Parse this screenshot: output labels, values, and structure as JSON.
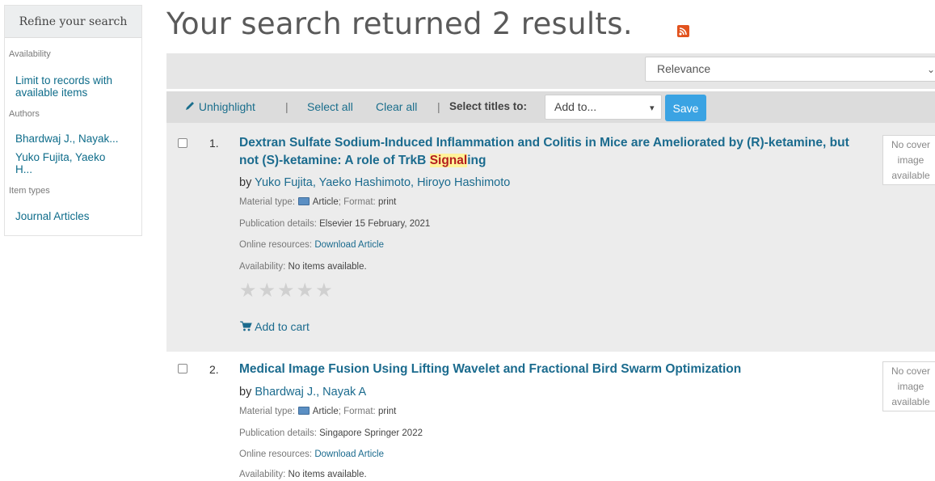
{
  "sidebar": {
    "heading": "Refine your search",
    "availability_label": "Availability",
    "availability_link": "Limit to records with available items",
    "authors_label": "Authors",
    "authors": [
      "Bhardwaj J., Nayak...",
      "Yuko Fujita, Yaeko H..."
    ],
    "item_types_label": "Item types",
    "item_types": [
      "Journal Articles"
    ]
  },
  "header": {
    "title": "Your search returned 2 results."
  },
  "sort": {
    "selected": "Relevance"
  },
  "toolbar": {
    "unhighlight": "Unhighlight",
    "select_all": "Select all",
    "clear_all": "Clear all",
    "select_titles_label": "Select titles to:",
    "add_to_value": "Add to...",
    "save": "Save"
  },
  "results": [
    {
      "number": "1.",
      "title_before": "Dextran Sulfate Sodium-Induced Inflammation and Colitis in Mice are Ameliorated by (R)-ketamine, but not (S)-ketamine: A role of TrkB ",
      "title_highlight": "Signal",
      "title_after": "ing",
      "by": "by",
      "authors": "Yuko Fujita, Yaeko Hashimoto, Hiroyo Hashimoto",
      "material_label": "Material type:",
      "material_value": "Article",
      "format_label": "; Format:",
      "format_value": "print",
      "publication_label": "Publication details:",
      "publication_value": "Elsevier 15 February, 2021",
      "online_label": "Online resources:",
      "online_link": "Download Article",
      "availability_label": "Availability:",
      "availability_value": "No items available.",
      "add_to_cart": "Add to cart",
      "cover_text": "No cover image available"
    },
    {
      "number": "2.",
      "title_before": "Medical Image Fusion Using Lifting Wavelet and Fractional Bird Swarm Optimization",
      "by": "by",
      "authors": "Bhardwaj J., Nayak A",
      "material_label": "Material type:",
      "material_value": "Article",
      "format_label": "; Format:",
      "format_value": "print",
      "publication_label": "Publication details:",
      "publication_value": "Singapore Springer 2022",
      "online_label": "Online resources:",
      "online_link": "Download Article",
      "availability_label": "Availability:",
      "availability_value": "No items available.",
      "cover_text": "No cover image available"
    }
  ],
  "icons": {
    "rss": "rss-feed-icon",
    "pencil": "pencil-icon",
    "cart": "shopping-cart-icon",
    "book": "article-book-icon",
    "star": "star-rating-icon",
    "chevron": "chevron-down-icon"
  },
  "colors": {
    "link": "#1b6b8e",
    "highlight_bg": "#fff29a",
    "highlight_text": "#b41e1e",
    "save_button": "#3aa3e3",
    "rss": "#e2531e",
    "result_bg": "#ececec"
  }
}
